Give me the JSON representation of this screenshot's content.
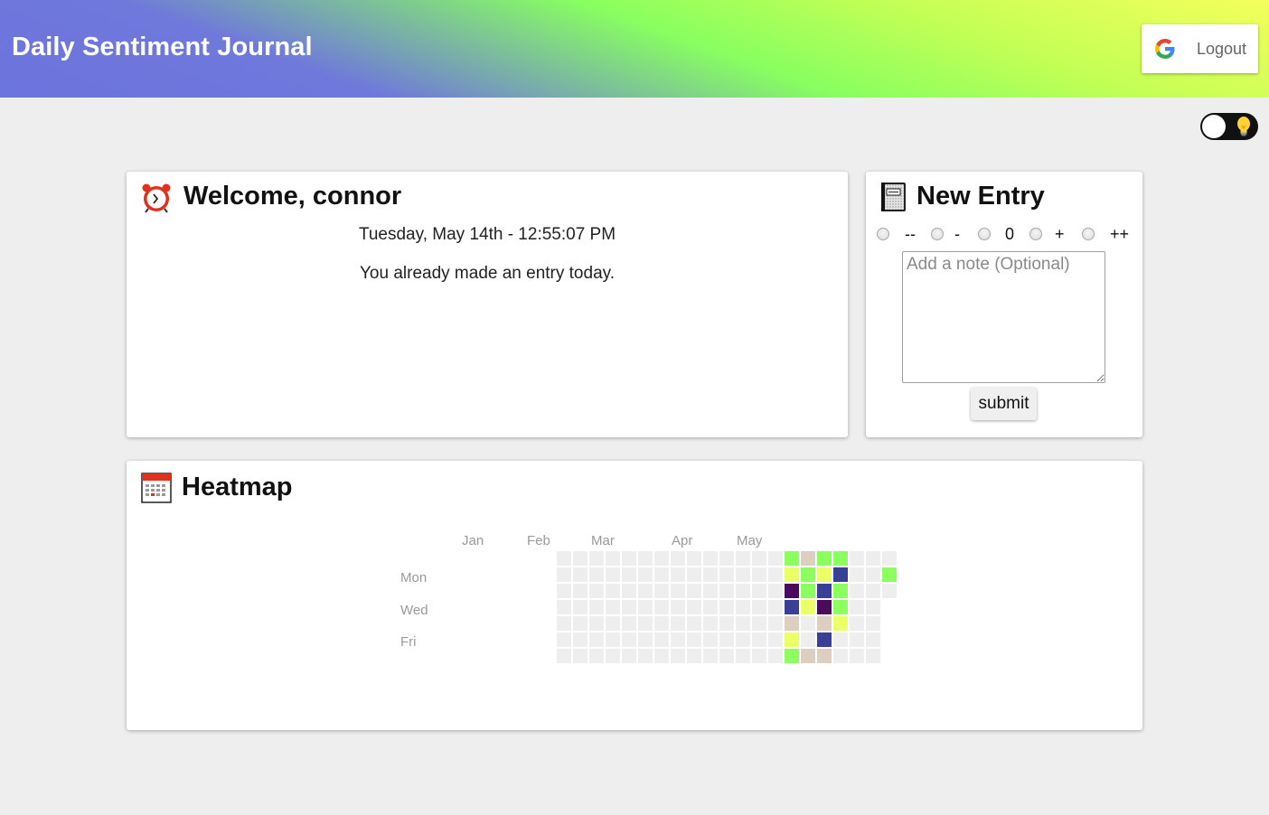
{
  "header": {
    "title": "Daily Sentiment Journal",
    "logout_label": "Logout"
  },
  "theme_toggle": {
    "mode": "light",
    "icon": "lightbulb-icon"
  },
  "welcome": {
    "title": "Welcome, connor",
    "icon": "alarm-clock-icon",
    "datetime": "Tuesday, May 14th - 12:55:07 PM",
    "message": "You already made an entry today."
  },
  "new_entry": {
    "title": "New Entry",
    "icon": "notebook-icon",
    "options": [
      "--",
      "-",
      "0",
      "+",
      "++"
    ],
    "note_placeholder": "Add a note (Optional)",
    "submit_label": "submit"
  },
  "heatmap": {
    "title": "Heatmap",
    "icon": "calendar-icon",
    "months": [
      "Jan",
      "Feb",
      "Mar",
      "Apr",
      "May"
    ],
    "day_labels": [
      "",
      "Mon",
      "",
      "Wed",
      "",
      "Fri",
      ""
    ],
    "legend_colors": {
      "empty": "#eeeeee",
      "--": "#4b0a5e",
      "-": "#3a3f96",
      "0": "#dccfc2",
      "+": "#ebff66",
      "++": "#8bff5e"
    },
    "weeks": [
      [
        "e",
        "e",
        "e",
        "e",
        "e",
        "e",
        "e"
      ],
      [
        "e",
        "e",
        "e",
        "e",
        "e",
        "e",
        "e"
      ],
      [
        "e",
        "e",
        "e",
        "e",
        "e",
        "e",
        "e"
      ],
      [
        "e",
        "e",
        "e",
        "e",
        "e",
        "e",
        "e"
      ],
      [
        "e",
        "e",
        "e",
        "e",
        "e",
        "e",
        "e"
      ],
      [
        "e",
        "e",
        "e",
        "e",
        "e",
        "e",
        "e"
      ],
      [
        "e",
        "e",
        "e",
        "e",
        "e",
        "e",
        "e"
      ],
      [
        "e",
        "e",
        "e",
        "e",
        "e",
        "e",
        "e"
      ],
      [
        "e",
        "e",
        "e",
        "e",
        "e",
        "e",
        "e"
      ],
      [
        "e",
        "e",
        "e",
        "e",
        "e",
        "e",
        "e"
      ],
      [
        "e",
        "e",
        "e",
        "e",
        "e",
        "e",
        "e"
      ],
      [
        "e",
        "e",
        "e",
        "e",
        "e",
        "e",
        "e"
      ],
      [
        "e",
        "e",
        "e",
        "e",
        "e",
        "e",
        "e"
      ],
      [
        "e",
        "e",
        "e",
        "e",
        "e",
        "e",
        "e"
      ],
      [
        "++",
        "+",
        "--",
        "-",
        "0",
        "+",
        "++"
      ],
      [
        "0",
        "++",
        "++",
        "+",
        "e",
        "e",
        "0"
      ],
      [
        "++",
        "+",
        "-",
        "--",
        "0",
        "-",
        "0"
      ],
      [
        "++",
        "-",
        "++",
        "++",
        "+",
        "e",
        "e"
      ],
      [
        "e",
        "e",
        "e",
        "e",
        "e",
        "e",
        "e"
      ],
      [
        "e",
        "e",
        "e",
        "e",
        "e",
        "e",
        "e"
      ],
      [
        "e",
        "++",
        "e",
        null,
        null,
        null,
        null
      ]
    ]
  }
}
